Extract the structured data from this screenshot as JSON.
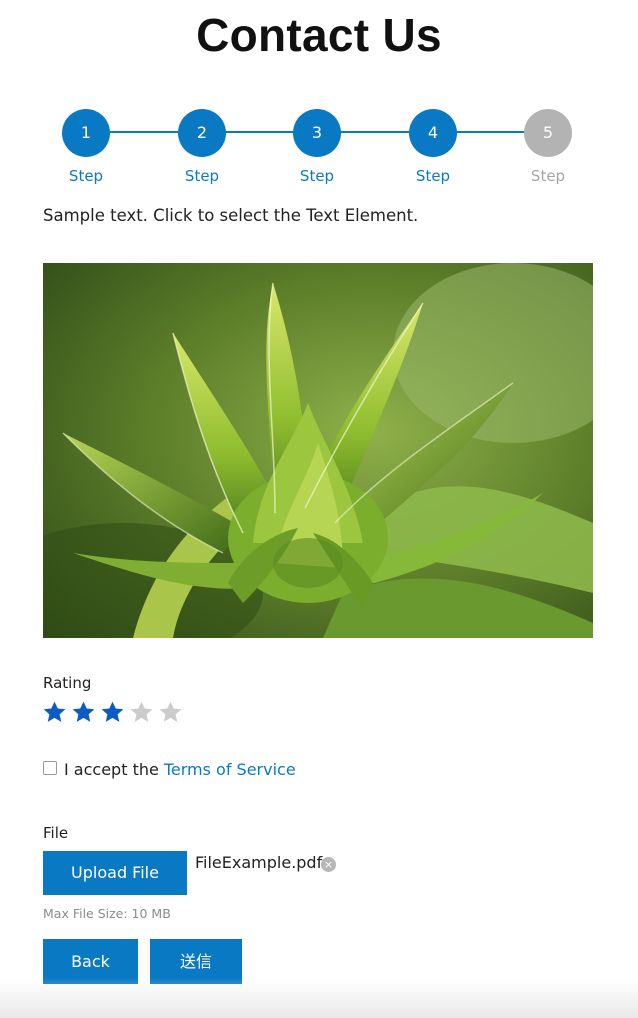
{
  "page": {
    "title": "Contact Us"
  },
  "stepper": {
    "steps": [
      {
        "number": "1",
        "label": "Step",
        "state": "complete"
      },
      {
        "number": "2",
        "label": "Step",
        "state": "complete"
      },
      {
        "number": "3",
        "label": "Step",
        "state": "complete"
      },
      {
        "number": "4",
        "label": "Step",
        "state": "current"
      },
      {
        "number": "5",
        "label": "Step",
        "state": "inactive"
      }
    ],
    "active_color": "#0a79c4",
    "inactive_color": "#b3b3b3"
  },
  "intro_text": "Sample text. Click to select the Text Element.",
  "image": {
    "subject": "close-up of green sunflower bud"
  },
  "rating": {
    "label": "Rating",
    "value": 3,
    "max": 5,
    "filled_color": "#0a5cc4",
    "empty_color": "#cccccc"
  },
  "terms": {
    "checked": false,
    "prefix": "I accept the",
    "link_text": "Terms of Service"
  },
  "file": {
    "label": "File",
    "upload_button": "Upload File",
    "file_name": "FileExample.pdf",
    "remove_icon": "×",
    "hint": "Max File Size: 10 MB"
  },
  "actions": {
    "back": "Back",
    "submit": "送信"
  }
}
